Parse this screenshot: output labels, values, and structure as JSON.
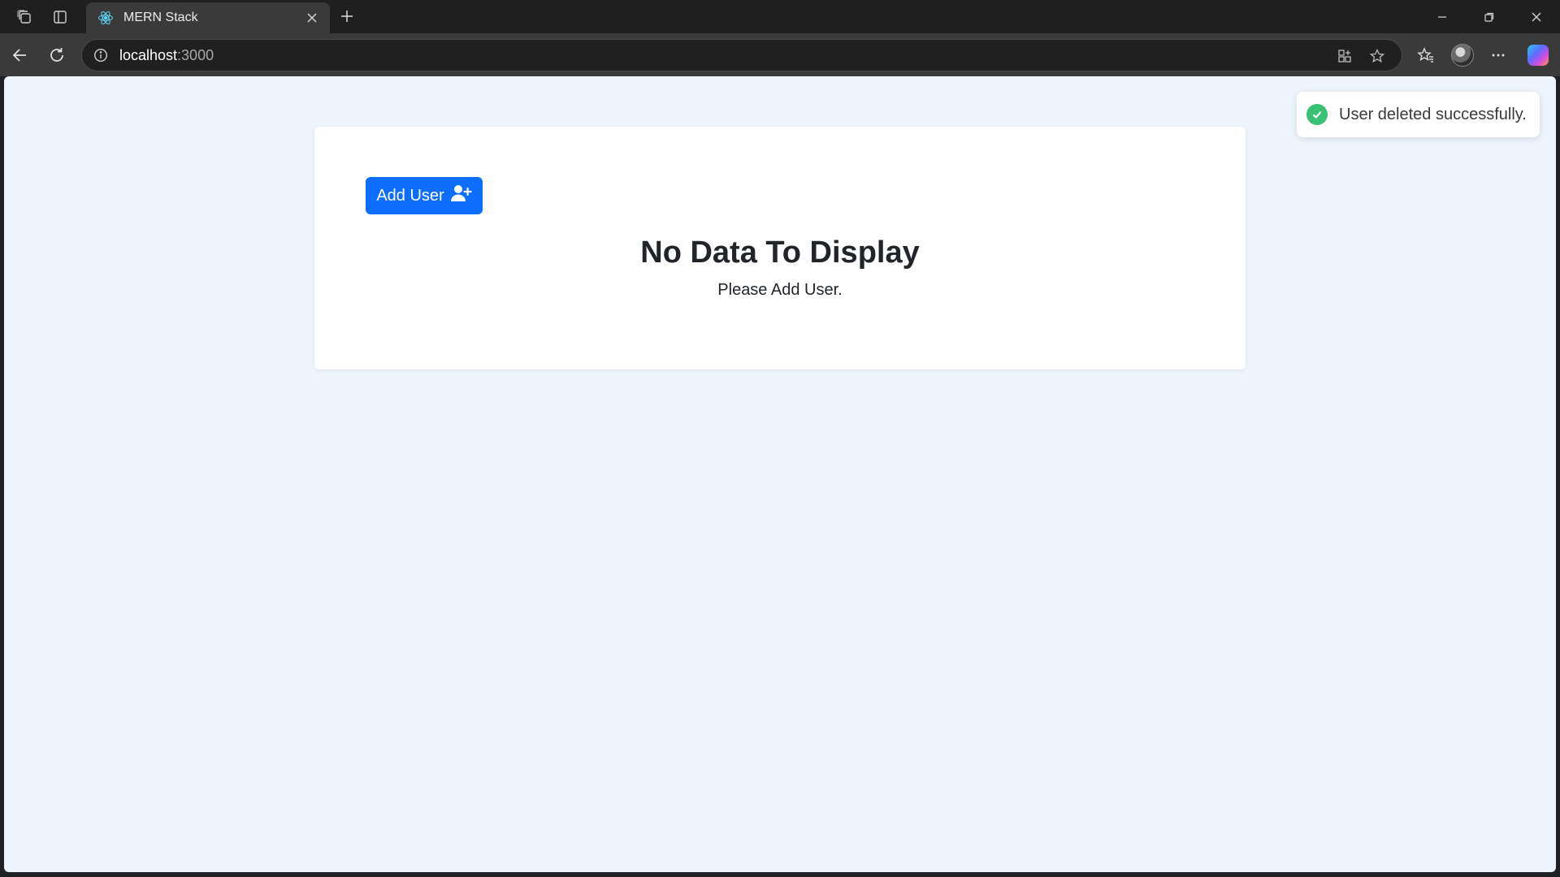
{
  "browser": {
    "tab": {
      "title": "MERN Stack",
      "favicon": "react-icon"
    },
    "address": {
      "host": "localhost",
      "port": ":3000"
    },
    "icons": [
      "workspaces-icon",
      "vertical-tabs-icon",
      "close-icon",
      "plus-icon",
      "minimize-icon",
      "restore-icon",
      "back-icon",
      "refresh-icon",
      "info-icon",
      "app-available-icon",
      "star-icon",
      "favorites-icon",
      "more-icon",
      "copilot-icon"
    ]
  },
  "page": {
    "add_button_label": "Add User",
    "empty_title": "No Data To Display",
    "empty_subtitle": "Please Add User."
  },
  "toast": {
    "message": "User deleted successfully."
  },
  "colors": {
    "primary": "#0d6efd",
    "success": "#38c172",
    "page_bg": "#eef5fe"
  }
}
